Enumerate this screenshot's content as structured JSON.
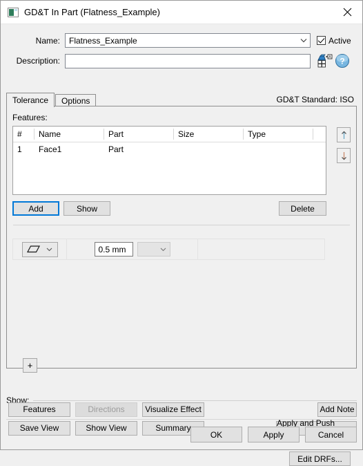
{
  "window": {
    "title": "GD&T In Part (Flatness_Example)",
    "icon": "part-window-icon",
    "close_icon": "close-icon"
  },
  "form": {
    "name_label": "Name:",
    "name_value": "Flatness_Example",
    "name_dropdown_icon": "chevron-down-icon",
    "active_label": "Active",
    "active_checked": true,
    "description_label": "Description:",
    "description_value": "",
    "datum_icon": "datum-reference-icon",
    "help_icon": "help-icon"
  },
  "tabs": {
    "items": [
      {
        "label": "Tolerance",
        "active": true
      },
      {
        "label": "Options",
        "active": false
      }
    ],
    "standard_label": "GD&T Standard: ISO"
  },
  "tolerance_tab": {
    "features_label": "Features:",
    "table": {
      "columns": [
        "#",
        "Name",
        "Part",
        "Size",
        "Type"
      ],
      "rows": [
        {
          "num": "1",
          "name": "Face1",
          "part": "Part",
          "size": "",
          "type": ""
        }
      ]
    },
    "move_up_icon": "arrow-up-icon",
    "move_down_icon": "arrow-down-icon",
    "add_label": "Add",
    "show_label": "Show",
    "delete_label": "Delete",
    "frame": {
      "symbol_icon": "flatness-symbol-icon",
      "symbol_dropdown_icon": "chevron-down-icon",
      "tolerance_value": "0.5 mm",
      "modifier_value": "",
      "modifier_dropdown_icon": "chevron-down-icon"
    },
    "add_frame_label": "+",
    "edit_drfs_label": "Edit DRFs..."
  },
  "show_group": {
    "label": "Show:",
    "buttons": [
      {
        "label": "Features",
        "disabled": false
      },
      {
        "label": "Directions",
        "disabled": true
      },
      {
        "label": "Visualize Effect",
        "disabled": false
      },
      {
        "label": "Add Note",
        "disabled": false
      },
      {
        "label": "Save View",
        "disabled": false
      },
      {
        "label": "Show View",
        "disabled": false
      },
      {
        "label": "Summary",
        "disabled": false
      },
      {
        "label": "Apply and Push GD&T",
        "disabled": false
      }
    ]
  },
  "footer": {
    "ok_label": "OK",
    "apply_label": "Apply",
    "cancel_label": "Cancel"
  },
  "colors": {
    "focus_blue": "#0078d7",
    "dialog_bg": "#f0f0f0",
    "field_bg": "#ffffff"
  }
}
